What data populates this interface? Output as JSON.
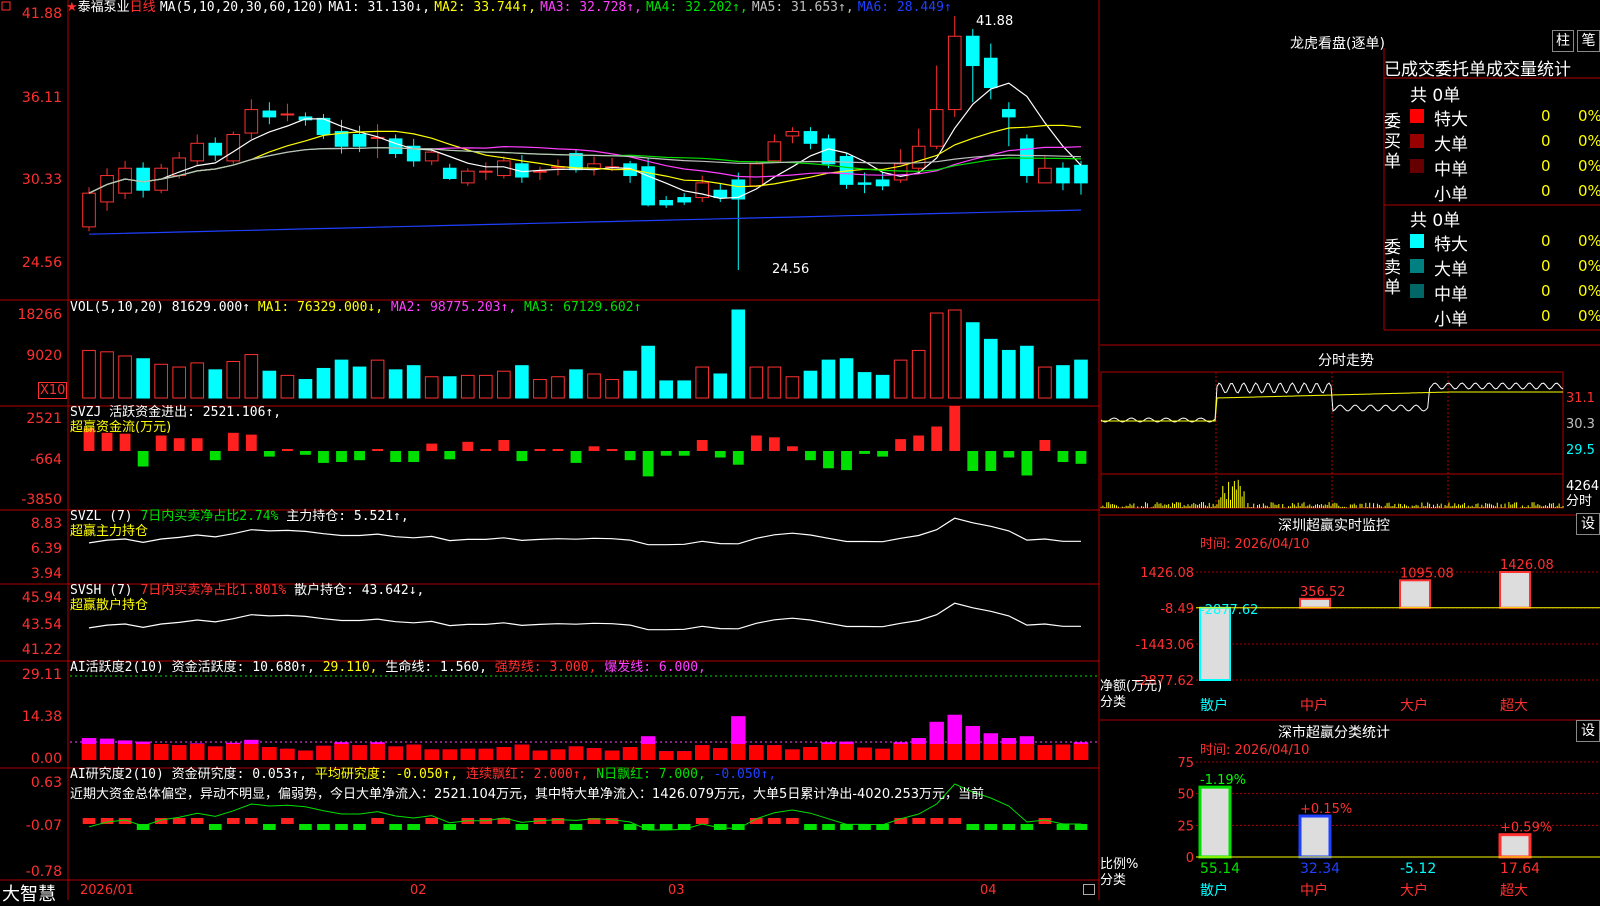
{
  "stock": {
    "star": "★",
    "name": "泰福泵业",
    "period": "日线"
  },
  "main": {
    "ma_header": "MA(5,10,20,30,60,120)",
    "ma": [
      {
        "label": "MA1: 31.130↓,",
        "color": "#ffffff"
      },
      {
        "label": "MA2: 33.744↑,",
        "color": "#ffff00"
      },
      {
        "label": "MA3: 32.728↑,",
        "color": "#ff40ff"
      },
      {
        "label": "MA4: 32.202↑,",
        "color": "#00e000"
      },
      {
        "label": "MA5: 31.653↑,",
        "color": "#c0c0c0"
      },
      {
        "label": "MA6: 28.449↑",
        "color": "#2040ff"
      }
    ],
    "y_ticks": [
      "41.88",
      "36.11",
      "30.33",
      "24.56"
    ],
    "high_note": "41.88",
    "low_note": "24.56",
    "candles": [
      [
        27.5,
        29.8,
        27.2,
        30.2
      ],
      [
        29.2,
        31.0,
        28.6,
        31.5
      ],
      [
        29.8,
        31.5,
        29.4,
        32.0
      ],
      [
        31.5,
        30.0,
        29.5,
        31.9
      ],
      [
        30.0,
        31.5,
        29.8,
        31.8
      ],
      [
        31.0,
        32.2,
        30.8,
        32.6
      ],
      [
        32.0,
        33.2,
        31.7,
        33.8
      ],
      [
        33.2,
        32.4,
        32.0,
        33.6
      ],
      [
        32.0,
        33.8,
        31.8,
        34.0
      ],
      [
        33.9,
        35.5,
        33.5,
        36.2
      ],
      [
        35.4,
        35.0,
        34.5,
        36.0
      ],
      [
        35.2,
        35.2,
        34.7,
        35.9
      ],
      [
        35.0,
        34.8,
        34.4,
        35.3
      ],
      [
        34.9,
        33.8,
        33.5,
        35.2
      ],
      [
        34.0,
        33.0,
        32.5,
        34.8
      ],
      [
        33.8,
        33.0,
        32.6,
        34.4
      ],
      [
        33.6,
        33.6,
        32.2,
        34.5
      ],
      [
        33.5,
        32.5,
        32.2,
        33.8
      ],
      [
        33.0,
        32.0,
        31.6,
        33.5
      ],
      [
        32.0,
        32.6,
        31.7,
        32.8
      ],
      [
        31.5,
        30.8,
        30.7,
        31.8
      ],
      [
        30.5,
        31.3,
        30.3,
        31.5
      ],
      [
        31.3,
        31.3,
        30.7,
        31.9
      ],
      [
        31.0,
        32.0,
        30.8,
        32.3
      ],
      [
        31.8,
        30.9,
        30.5,
        32.4
      ],
      [
        31.3,
        31.3,
        30.7,
        31.6
      ],
      [
        31.6,
        31.6,
        31.0,
        32.1
      ],
      [
        32.5,
        31.4,
        31.2,
        32.8
      ],
      [
        31.5,
        31.8,
        31.0,
        32.3
      ],
      [
        31.6,
        31.6,
        31.3,
        32.2
      ],
      [
        31.8,
        31.0,
        30.5,
        32.0
      ],
      [
        31.6,
        29.0,
        28.9,
        32.2
      ],
      [
        29.3,
        29.0,
        28.8,
        29.6
      ],
      [
        29.5,
        29.2,
        29.0,
        29.8
      ],
      [
        29.5,
        30.5,
        29.2,
        31.0
      ],
      [
        30.0,
        29.5,
        29.2,
        30.5
      ],
      [
        30.7,
        29.4,
        24.56,
        31.2
      ],
      [
        30.3,
        31.8,
        30.2,
        32.0
      ],
      [
        32.0,
        33.3,
        32.0,
        33.8
      ],
      [
        33.7,
        34.0,
        33.2,
        34.3
      ],
      [
        34.0,
        33.2,
        32.8,
        34.3
      ],
      [
        33.5,
        31.8,
        31.5,
        33.8
      ],
      [
        32.3,
        30.4,
        30.1,
        32.5
      ],
      [
        30.5,
        30.4,
        29.8,
        31.2
      ],
      [
        30.7,
        30.3,
        30.0,
        31.2
      ],
      [
        30.7,
        31.8,
        30.5,
        32.8
      ],
      [
        31.5,
        33.0,
        31.2,
        34.2
      ],
      [
        33.0,
        35.5,
        32.8,
        38.5
      ],
      [
        35.5,
        40.5,
        35.0,
        41.88
      ],
      [
        40.5,
        38.5,
        36.0,
        41.0
      ],
      [
        39.0,
        37.0,
        36.2,
        40.0
      ],
      [
        35.5,
        35.0,
        33.0,
        36.0
      ],
      [
        33.5,
        31.0,
        30.5,
        33.8
      ],
      [
        30.5,
        31.5,
        30.5,
        32.3
      ],
      [
        31.5,
        30.5,
        30.0,
        31.9
      ],
      [
        31.7,
        30.5,
        29.7,
        32.0
      ]
    ]
  },
  "vol": {
    "header": "VOL(5,10,20)",
    "value": "81629.000↑",
    "ma1": "MA1: 76329.000↓,",
    "ma2": "MA2: 98775.203↑,",
    "ma3": "MA3: 67129.602↑",
    "y_ticks": [
      "18266",
      "9020"
    ],
    "unit": "X10"
  },
  "svzj": {
    "header": "SVZJ  活跃资金进出: 2521.106↑,",
    "sub": "超赢资金流(万元)",
    "y_ticks": [
      "2521",
      "-664",
      "-3850"
    ]
  },
  "svzl": {
    "header_a": "SVZL (7)",
    "header_b": "7日内买卖净占比2.74%",
    "header_c": "主力持仓: 5.521↑,",
    "sub": "超赢主力持仓",
    "y_ticks": [
      "8.83",
      "6.39",
      "3.94"
    ]
  },
  "svsh": {
    "header_a": "SVSH (7)",
    "header_b": "7日内买卖净占比1.801%",
    "header_c": "散户持仓: 43.642↓,",
    "sub": "超赢散户持仓",
    "y_ticks": [
      "45.94",
      "43.54",
      "41.22"
    ]
  },
  "ai1": {
    "header": "AI活跃度2(10) 资金活跃度: 10.680↑,",
    "v2": "29.110,",
    "v3": "生命线: 1.560,",
    "v4": "强势线: 3.000,",
    "v5": "爆发线: 6.000,",
    "y_ticks": [
      "29.11",
      "14.38",
      "0.00"
    ]
  },
  "ai2": {
    "header": "AI研究度2(10) 资金研究度: 0.053↑,",
    "v2": "平均研究度: -0.050↑,",
    "v3": "连续飘红: 2.000↑,",
    "v4": "N日飘红: 7.000,",
    "v5": "-0.050↑,",
    "text": "近期大资金总体偏空，异动不明显，偏弱势，今日大单净流入：2521.104万元，其中特大单净流入：1426.079万元，大单5日累计净出-4020.253万元，当前",
    "y_ticks": [
      "0.63",
      "-0.07",
      "-0.78"
    ]
  },
  "bottom": {
    "brand": "大智慧",
    "dates": [
      "2026/01",
      "02",
      "03",
      "04"
    ]
  },
  "right": {
    "lhb_title": "龙虎看盘(逐单)",
    "btn1": "柱",
    "btn2": "笔",
    "tabs": "已成交委托单成交量统计",
    "buy_side": "委买单",
    "sell_side": "委卖单",
    "buy_total": "共 0单",
    "sell_total": "共 0单",
    "buy_rows": [
      {
        "label": "特大",
        "count": "0",
        "pct": "0%",
        "color": "#ff0000"
      },
      {
        "label": "大单",
        "count": "0",
        "pct": "0%",
        "color": "#990000"
      },
      {
        "label": "中单",
        "count": "0",
        "pct": "0%",
        "color": "#660000"
      },
      {
        "label": "小单",
        "count": "0",
        "pct": "0%",
        "color": "#000000"
      }
    ],
    "sell_rows": [
      {
        "label": "特大",
        "count": "0",
        "pct": "0%",
        "color": "#00ffff"
      },
      {
        "label": "大单",
        "count": "0",
        "pct": "0%",
        "color": "#008080"
      },
      {
        "label": "中单",
        "count": "0",
        "pct": "0%",
        "color": "#006666"
      },
      {
        "label": "小单",
        "count": "0",
        "pct": "0%",
        "color": "#000000"
      }
    ],
    "fs_title": "分时走势",
    "fs_prices": [
      "31.1",
      "30.3",
      "29.5"
    ],
    "fs_vol": "4264",
    "fs_vol_label": "分时",
    "sz_title": "深圳超赢实时监控",
    "sz_btn": "设",
    "sz_time": "时间: 2026/04/10",
    "sz_y": [
      "1426.08",
      "-8.49",
      "-1443.06",
      "-2877.62"
    ],
    "sz_bars": [
      {
        "label": "散户",
        "value": -2877.62,
        "text": "-2877.62"
      },
      {
        "label": "中户",
        "value": 356.52,
        "text": "356.52"
      },
      {
        "label": "大户",
        "value": 1095.08,
        "text": "1095.08"
      },
      {
        "label": "超大",
        "value": 1426.08,
        "text": "1426.08"
      }
    ],
    "sz_unit_a": "净额(万元)",
    "sz_unit_b": "分类",
    "fl_title": "深市超赢分类统计",
    "fl_btn": "设",
    "fl_time": "时间: 2026/04/10",
    "fl_y": [
      "75",
      "50",
      "25",
      "0"
    ],
    "fl_bars": [
      {
        "label": "散户",
        "value": 55.14,
        "val_text": "55.14",
        "chg": "-1.19%"
      },
      {
        "label": "中户",
        "value": 32.34,
        "val_text": "32.34",
        "chg": "+0.15%"
      },
      {
        "label": "大户",
        "value": -5.12,
        "val_text": "-5.12",
        "chg": ""
      },
      {
        "label": "超大",
        "value": 17.64,
        "val_text": "17.64",
        "chg": "+0.59%"
      }
    ],
    "fl_unit_a": "比例%",
    "fl_unit_b": "分类"
  }
}
